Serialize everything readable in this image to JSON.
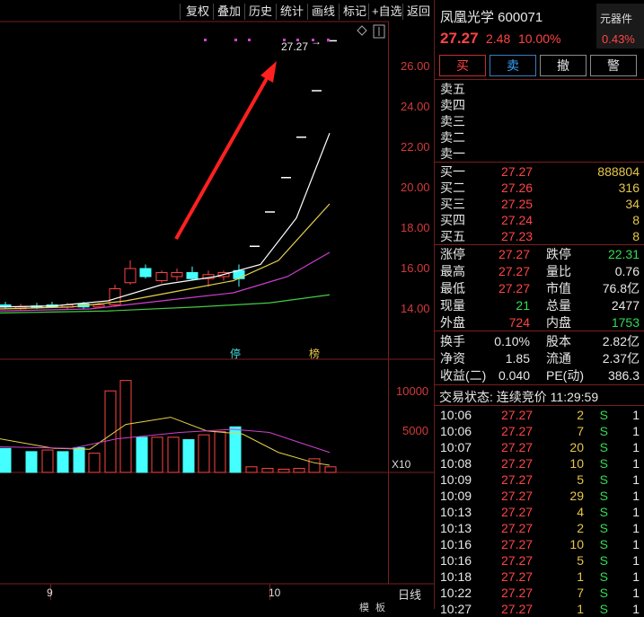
{
  "toolbar": {
    "buttons": [
      "复权",
      "叠加",
      "历史",
      "统计",
      "画线",
      "标记",
      "+自选",
      "返回"
    ]
  },
  "price_axis": [
    "26.00",
    "24.00",
    "22.00",
    "20.00",
    "18.00",
    "16.00",
    "14.00"
  ],
  "volume_axis": [
    "10000",
    "5000"
  ],
  "volume_unit": "X10",
  "date_labels": [
    "9",
    "10"
  ],
  "period_label": "日线",
  "scroll_labels": [
    "模",
    "板"
  ],
  "chart_markers": {
    "high_price": "27.27",
    "halt_tag": "停",
    "rank_tag": "榜"
  },
  "stock": {
    "name_code": "凤凰光学 600071",
    "price": "27.27",
    "change": "2.48",
    "change_pct": "10.00%",
    "sector_label": "元器件",
    "sector_pct": "0.43%"
  },
  "actions": {
    "buy": "买",
    "sell": "卖",
    "cancel": "撤",
    "alert": "警"
  },
  "asks": [
    "卖五",
    "卖四",
    "卖三",
    "卖二",
    "卖一"
  ],
  "bids": [
    {
      "label": "买一",
      "price": "27.27",
      "vol": "888804"
    },
    {
      "label": "买二",
      "price": "27.26",
      "vol": "316"
    },
    {
      "label": "买三",
      "price": "27.25",
      "vol": "34"
    },
    {
      "label": "买四",
      "price": "27.24",
      "vol": "8"
    },
    {
      "label": "买五",
      "price": "27.23",
      "vol": "8"
    }
  ],
  "stats": [
    {
      "l1": "涨停",
      "v1": "27.27",
      "l2": "跌停",
      "v2": "22.31"
    },
    {
      "l1": "最高",
      "v1": "27.27",
      "l2": "量比",
      "v2": "0.76"
    },
    {
      "l1": "最低",
      "v1": "27.27",
      "l2": "市值",
      "v2": "76.8亿"
    },
    {
      "l1": "现量",
      "v1": "21",
      "l2": "总量",
      "v2": "2477"
    },
    {
      "l1": "外盘",
      "v1": "724",
      "l2": "内盘",
      "v2": "1753"
    }
  ],
  "fundamentals": [
    {
      "l1": "换手",
      "v1": "0.10%",
      "l2": "股本",
      "v2": "2.82亿"
    },
    {
      "l1": "净资",
      "v1": "1.85",
      "l2": "流通",
      "v2": "2.37亿"
    },
    {
      "l1": "收益(二)",
      "v1": "0.040",
      "l2": "PE(动)",
      "v2": "386.3"
    }
  ],
  "trade_status": "交易状态: 连续竞价 11:29:59",
  "ticks": [
    {
      "t": "10:06",
      "p": "27.27",
      "v": "2",
      "s": "S",
      "n": "1"
    },
    {
      "t": "10:06",
      "p": "27.27",
      "v": "7",
      "s": "S",
      "n": "1"
    },
    {
      "t": "10:07",
      "p": "27.27",
      "v": "20",
      "s": "S",
      "n": "1"
    },
    {
      "t": "10:08",
      "p": "27.27",
      "v": "10",
      "s": "S",
      "n": "1"
    },
    {
      "t": "10:09",
      "p": "27.27",
      "v": "5",
      "s": "S",
      "n": "1"
    },
    {
      "t": "10:09",
      "p": "27.27",
      "v": "29",
      "s": "S",
      "n": "1"
    },
    {
      "t": "10:13",
      "p": "27.27",
      "v": "4",
      "s": "S",
      "n": "1"
    },
    {
      "t": "10:13",
      "p": "27.27",
      "v": "2",
      "s": "S",
      "n": "1"
    },
    {
      "t": "10:16",
      "p": "27.27",
      "v": "10",
      "s": "S",
      "n": "1"
    },
    {
      "t": "10:16",
      "p": "27.27",
      "v": "5",
      "s": "S",
      "n": "1"
    },
    {
      "t": "10:18",
      "p": "27.27",
      "v": "1",
      "s": "S",
      "n": "1"
    },
    {
      "t": "10:22",
      "p": "27.27",
      "v": "7",
      "s": "S",
      "n": "1"
    },
    {
      "t": "10:27",
      "p": "27.27",
      "v": "1",
      "s": "S",
      "n": "1"
    }
  ],
  "colors": {
    "up": "#ff4444",
    "down": "#44ffff",
    "axis": "#d23a3a",
    "bg": "#000000"
  }
}
